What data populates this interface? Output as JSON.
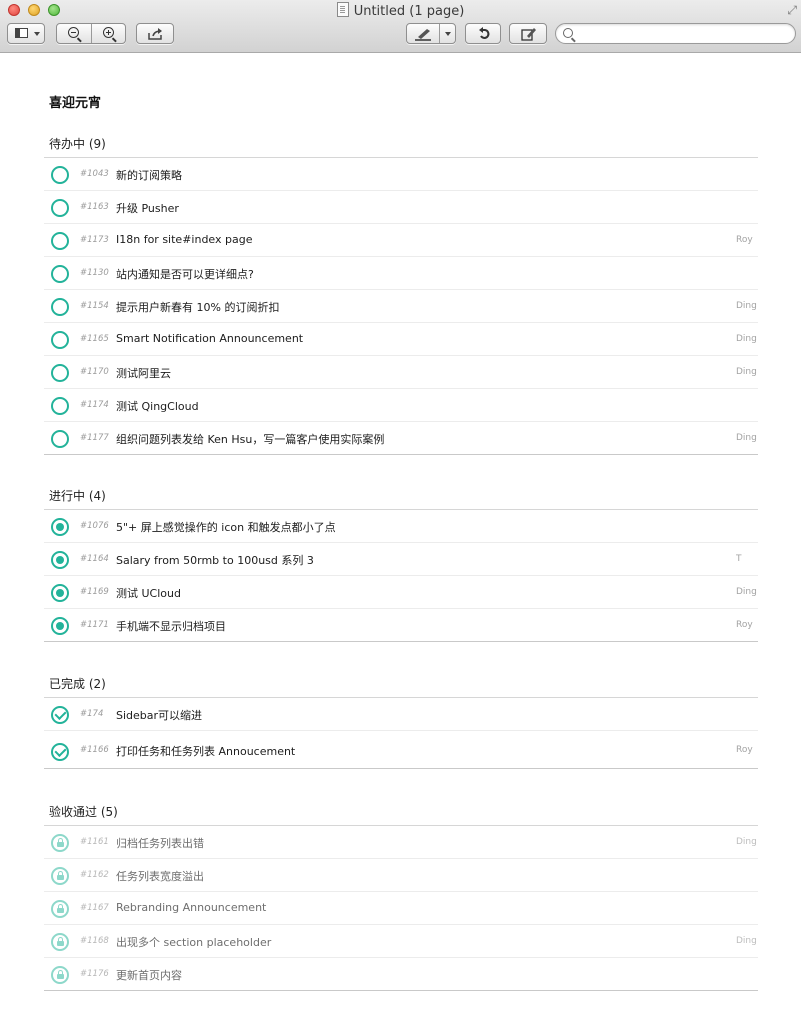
{
  "window": {
    "title": "Untitled (1 page)"
  },
  "toolbar": {
    "search": {
      "placeholder": "",
      "value": ""
    }
  },
  "document": {
    "title": "喜迎元宵",
    "sections": [
      {
        "heading": "待办中 (9)",
        "status": "todo",
        "items": [
          {
            "id": "#1043",
            "title": "新的订阅策略",
            "assignee": ""
          },
          {
            "id": "#1163",
            "title": "升级 Pusher",
            "assignee": ""
          },
          {
            "id": "#1173",
            "title": "I18n for site#index page",
            "assignee": "Roy"
          },
          {
            "id": "#1130",
            "title": "站内通知是否可以更详细点?",
            "assignee": ""
          },
          {
            "id": "#1154",
            "title": "提示用户新春有 10% 的订阅折扣",
            "assignee": "Ding"
          },
          {
            "id": "#1165",
            "title": "Smart Notification Announcement",
            "assignee": "Ding"
          },
          {
            "id": "#1170",
            "title": "测试阿里云",
            "assignee": "Ding"
          },
          {
            "id": "#1174",
            "title": "测试 QingCloud",
            "assignee": ""
          },
          {
            "id": "#1177",
            "title": "组织问题列表发给 Ken Hsu，写一篇客户使用实际案例",
            "assignee": "Ding"
          }
        ]
      },
      {
        "heading": "进行中 (4)",
        "status": "progress",
        "items": [
          {
            "id": "#1076",
            "title": "5\"+ 屏上感觉操作的 icon 和触发点都小了点",
            "assignee": ""
          },
          {
            "id": "#1164",
            "title": "Salary from 50rmb to 100usd 系列 3",
            "assignee": "T"
          },
          {
            "id": "#1169",
            "title": "测试 UCloud",
            "assignee": "Ding"
          },
          {
            "id": "#1171",
            "title": "手机端不显示归档项目",
            "assignee": "Roy"
          }
        ]
      },
      {
        "heading": "已完成 (2)",
        "status": "done",
        "items": [
          {
            "id": "#174",
            "title": "Sidebar可以缩进",
            "assignee": ""
          },
          {
            "id": "#1166",
            "title": "打印任务和任务列表 Annoucement",
            "assignee": "Roy"
          }
        ]
      },
      {
        "heading": "验收通过 (5)",
        "status": "locked",
        "items": [
          {
            "id": "#1161",
            "title": "归档任务列表出错",
            "assignee": "Ding"
          },
          {
            "id": "#1162",
            "title": "任务列表宽度溢出",
            "assignee": ""
          },
          {
            "id": "#1167",
            "title": "Rebranding Announcement",
            "assignee": ""
          },
          {
            "id": "#1168",
            "title": "出现多个 section placeholder",
            "assignee": "Ding"
          },
          {
            "id": "#1176",
            "title": "更新首页内容",
            "assignee": ""
          }
        ]
      }
    ]
  },
  "colors": {
    "accent": "#23b39a",
    "accent_light": "#8dd8ca"
  }
}
